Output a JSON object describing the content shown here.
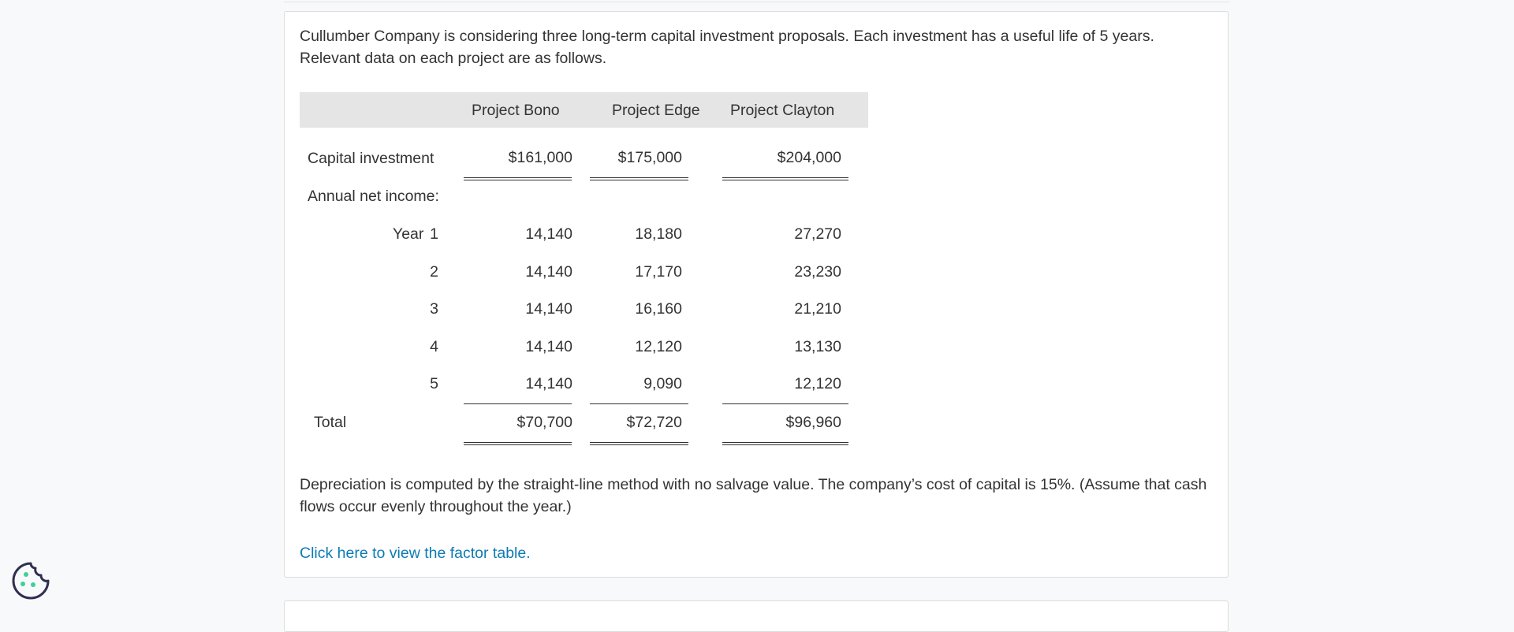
{
  "intro": "Cullumber Company is considering three long-term capital investment proposals. Each investment has a useful life of 5 years. Relevant data on each project are as follows.",
  "table": {
    "columns": [
      "Project Bono",
      "Project Edge",
      "Project Clayton"
    ],
    "capital_label": "Capital investment",
    "capital_values": [
      "$161,000",
      "$175,000",
      "$204,000"
    ],
    "annual_label": "Annual net income:",
    "year_word": "Year",
    "rows": [
      {
        "year": "1",
        "values": [
          "14,140",
          "18,180",
          "27,270"
        ]
      },
      {
        "year": "2",
        "values": [
          "14,140",
          "17,170",
          "23,230"
        ]
      },
      {
        "year": "3",
        "values": [
          "14,140",
          "16,160",
          "21,210"
        ]
      },
      {
        "year": "4",
        "values": [
          "14,140",
          "12,120",
          "13,130"
        ]
      },
      {
        "year": "5",
        "values": [
          "14,140",
          "9,090",
          "12,120"
        ]
      }
    ],
    "total_label": "Total",
    "total_values": [
      "$70,700",
      "$72,720",
      "$96,960"
    ]
  },
  "depreciation_note": "Depreciation is computed by the straight-line method with no salvage value. The company’s cost of capital is 15%. (Assume that cash flows occur evenly throughout the year.)",
  "factor_link": "Click here to view the factor table.",
  "colors": {
    "link": "#0d7bb5",
    "header_band": "#e5e5e5",
    "cookie_outline": "#2f2f52",
    "cookie_dots": "#3fcf9a"
  },
  "icons": {
    "cookie": "cookie-settings-icon"
  }
}
